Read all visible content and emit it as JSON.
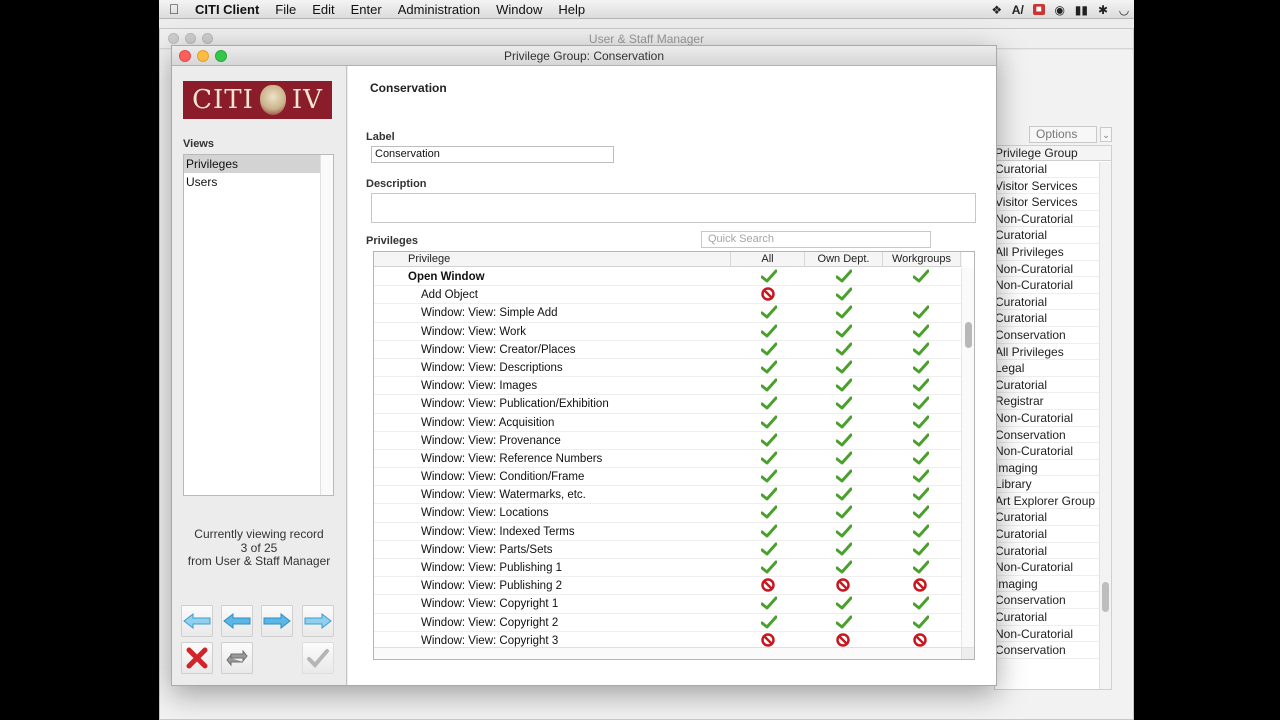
{
  "menubar": {
    "app": "CITI Client",
    "items": [
      "File",
      "Edit",
      "Enter",
      "Administration",
      "Window",
      "Help"
    ]
  },
  "background_window": {
    "title": "User & Staff Manager",
    "options_label": "Options",
    "list_header": "Privilege Group",
    "list": [
      "Curatorial",
      "Visitor Services",
      "Visitor Services",
      "Non-Curatorial",
      "Curatorial",
      "All Privileges",
      "Non-Curatorial",
      "Non-Curatorial",
      "Curatorial",
      "Curatorial",
      "Conservation",
      "All Privileges",
      "Legal",
      "Curatorial",
      "Registrar",
      "Non-Curatorial",
      "Conservation",
      "Non-Curatorial",
      "Imaging",
      "Library",
      "Art Explorer Group",
      "Curatorial",
      "Curatorial",
      "Curatorial",
      "Non-Curatorial",
      "Imaging",
      "Conservation",
      "Curatorial",
      "Non-Curatorial",
      "Conservation"
    ]
  },
  "window": {
    "title": "Privilege Group: Conservation"
  },
  "sidebar": {
    "logo_text_left": "CITI",
    "logo_text_right": "IV",
    "views_label": "Views",
    "views": [
      {
        "label": "Privileges",
        "selected": true
      },
      {
        "label": "Users",
        "selected": false
      }
    ],
    "record_line1": "Currently viewing record",
    "record_line2": "3 of 25",
    "record_line3": "from User & Staff Manager"
  },
  "form": {
    "heading": "Conservation",
    "label_caption": "Label",
    "label_value": "Conservation",
    "description_caption": "Description",
    "description_value": "",
    "privileges_caption": "Privileges",
    "quick_search_placeholder": "Quick Search"
  },
  "table": {
    "columns": [
      "Privilege",
      "All",
      "Own Dept.",
      "Workgroups"
    ],
    "rows": [
      {
        "name": "Open Window",
        "group": true,
        "all": "yes",
        "own": "yes",
        "wg": "yes"
      },
      {
        "name": "Add Object",
        "all": "no",
        "own": "yes",
        "wg": ""
      },
      {
        "name": "Window: View: Simple Add",
        "all": "yes",
        "own": "yes",
        "wg": "yes"
      },
      {
        "name": "Window: View: Work",
        "all": "yes",
        "own": "yes",
        "wg": "yes"
      },
      {
        "name": "Window: View: Creator/Places",
        "all": "yes",
        "own": "yes",
        "wg": "yes"
      },
      {
        "name": "Window: View: Descriptions",
        "all": "yes",
        "own": "yes",
        "wg": "yes"
      },
      {
        "name": "Window: View: Images",
        "all": "yes",
        "own": "yes",
        "wg": "yes"
      },
      {
        "name": "Window: View: Publication/Exhibition",
        "all": "yes",
        "own": "yes",
        "wg": "yes"
      },
      {
        "name": "Window: View: Acquisition",
        "all": "yes",
        "own": "yes",
        "wg": "yes"
      },
      {
        "name": "Window: View: Provenance",
        "all": "yes",
        "own": "yes",
        "wg": "yes"
      },
      {
        "name": "Window: View: Reference Numbers",
        "all": "yes",
        "own": "yes",
        "wg": "yes"
      },
      {
        "name": "Window: View: Condition/Frame",
        "all": "yes",
        "own": "yes",
        "wg": "yes"
      },
      {
        "name": "Window: View: Watermarks, etc.",
        "all": "yes",
        "own": "yes",
        "wg": "yes"
      },
      {
        "name": "Window: View: Locations",
        "all": "yes",
        "own": "yes",
        "wg": "yes"
      },
      {
        "name": "Window: View: Indexed Terms",
        "all": "yes",
        "own": "yes",
        "wg": "yes"
      },
      {
        "name": "Window: View: Parts/Sets",
        "all": "yes",
        "own": "yes",
        "wg": "yes"
      },
      {
        "name": "Window: View: Publishing 1",
        "all": "yes",
        "own": "yes",
        "wg": "yes"
      },
      {
        "name": "Window: View: Publishing 2",
        "all": "no",
        "own": "no",
        "wg": "no"
      },
      {
        "name": "Window: View: Copyright 1",
        "all": "yes",
        "own": "yes",
        "wg": "yes"
      },
      {
        "name": "Window: View: Copyright 2",
        "all": "yes",
        "own": "yes",
        "wg": "yes"
      },
      {
        "name": "Window: View: Copyright 3",
        "all": "no",
        "own": "no",
        "wg": "no"
      }
    ]
  },
  "colors": {
    "check_green": "#4aa02c",
    "deny_red": "#c8171e",
    "logo_bg": "#8b1c2a",
    "nav_arrow": "#5bb7e6"
  },
  "icons": {
    "yes": "checkmark-icon",
    "no": "denied-icon"
  }
}
